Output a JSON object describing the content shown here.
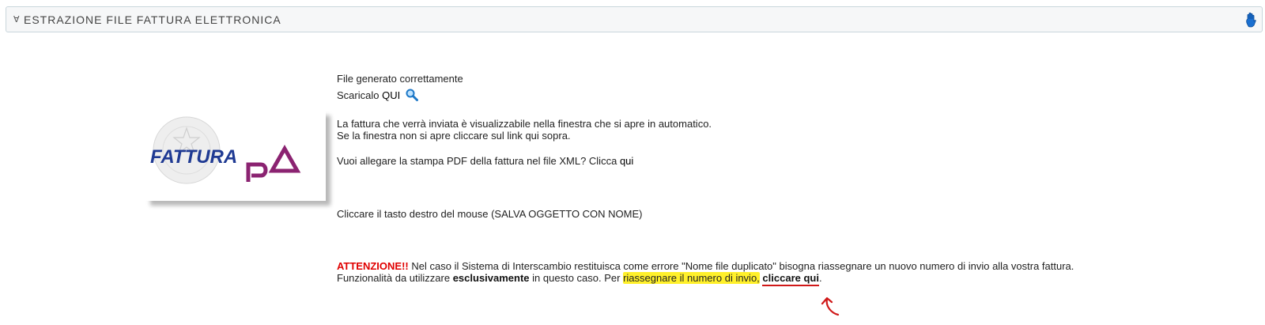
{
  "header": {
    "title": "ESTRAZIONE FILE FATTURA ELETTRONICA",
    "collapse_icon": "chevron-icon",
    "help_icon": "hand-icon"
  },
  "logo": {
    "text_line1": "FATTURA",
    "text_line2": "PA"
  },
  "content": {
    "status": "File generato correttamente",
    "download_prefix": "Scaricalo",
    "download_link": "QUI",
    "info_line1": "La fattura che verrà inviata è visualizzabile nella finestra che si apre in automatico.",
    "info_line2": "Se la finestra non si apre cliccare sul link qui sopra.",
    "pdf_question": "Vuoi allegare la stampa PDF della fattura nel file XML? Clicca",
    "pdf_link": "qui",
    "right_click_hint": "Cliccare il tasto destro del mouse (SALVA OGGETTO CON NOME)",
    "warning_label": "ATTENZIONE!!",
    "warning_text": "Nel caso il Sistema di Interscambio restituisca come errore \"Nome file duplicato\" bisogna riassegnare un nuovo numero di invio alla vostra fattura.",
    "func_prefix": "Funzionalità da utilizzare",
    "func_bold": "esclusivamente",
    "func_mid": "in questo caso. Per",
    "func_highlight": "riassegnare il numero di invio,",
    "func_link": "cliccare qui",
    "func_end": "."
  },
  "colors": {
    "warning": "#e00000",
    "highlight": "#fff02a",
    "annotation": "#d01818",
    "logo_blue": "#1f3a93",
    "logo_purple": "#8b2371"
  }
}
